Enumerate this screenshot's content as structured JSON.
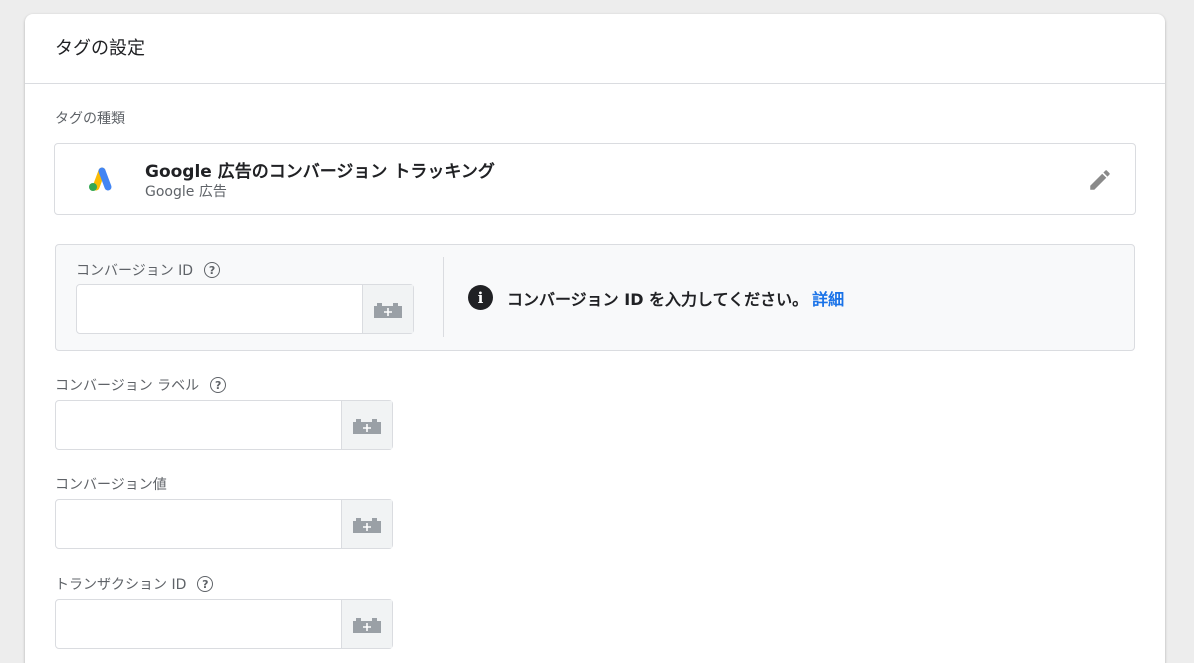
{
  "card": {
    "title": "タグの設定"
  },
  "tag_type": {
    "label": "タグの種類",
    "name": "Google 広告のコンバージョン トラッキング",
    "provider": "Google 広告",
    "logo_icon": "google-ads-logo",
    "edit_icon": "pencil-icon"
  },
  "fields": {
    "conversion_id": {
      "label": "コンバージョン ID",
      "value": "",
      "placeholder": ""
    },
    "conversion_label": {
      "label": "コンバージョン ラベル",
      "value": "",
      "placeholder": ""
    },
    "conversion_value": {
      "label": "コンバージョン値",
      "value": "",
      "placeholder": ""
    },
    "transaction_id": {
      "label": "トランザクション ID",
      "value": "",
      "placeholder": ""
    }
  },
  "info": {
    "message": "コンバージョン ID を入力してください。",
    "link": "詳細"
  },
  "colors": {
    "accent": "#1a73e8",
    "ads_blue": "#4285F4",
    "ads_yellow": "#FBBC04",
    "ads_green": "#34A853"
  }
}
